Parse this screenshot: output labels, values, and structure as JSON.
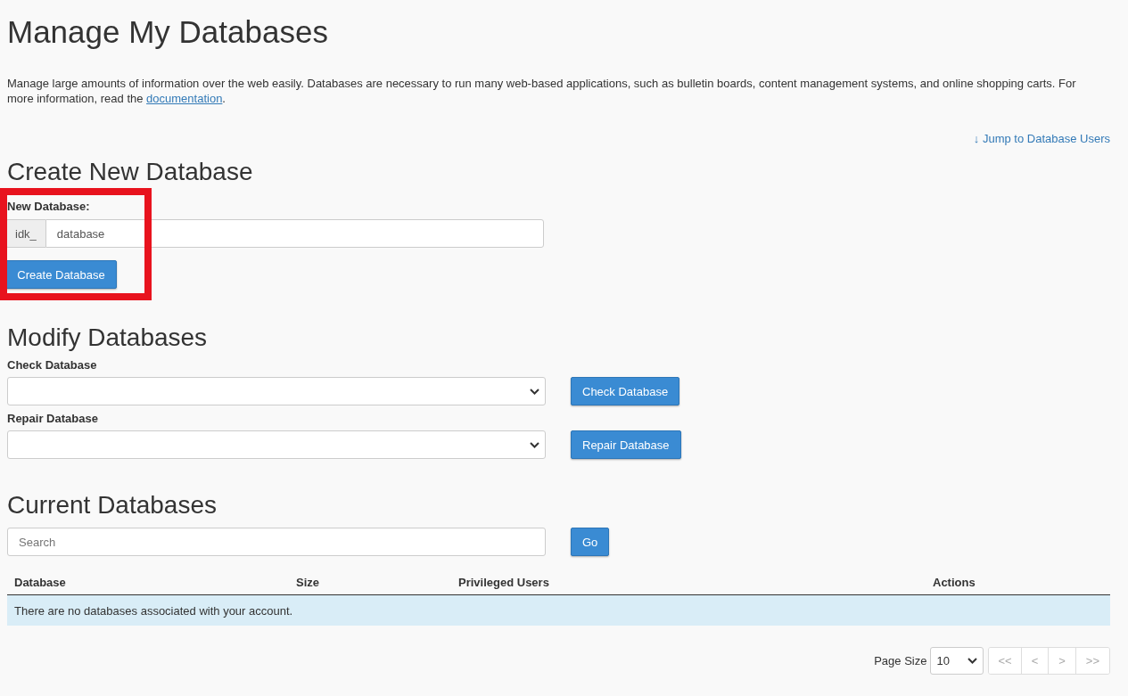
{
  "page_title": "Manage My Databases",
  "description": "Manage large amounts of information over the web easily. Databases are necessary to run many web-based applications, such as bulletin boards, content management systems, and online shopping carts. For more information, read the ",
  "description_link": "documentation",
  "description_end": ".",
  "jump_link": {
    "icon": "↓",
    "label": "Jump to Database Users"
  },
  "create_section": {
    "title": "Create New Database",
    "highlighted": true,
    "label": "New Database:",
    "prefix": "idk_",
    "value": "database",
    "button": "Create Database"
  },
  "modify_section": {
    "title": "Modify Databases",
    "rows": [
      {
        "label": "Check Database",
        "button": "Check Database"
      },
      {
        "label": "Repair Database",
        "button": "Repair Database"
      }
    ]
  },
  "current_section": {
    "title": "Current Databases",
    "search": {
      "placeholder": "Search"
    },
    "go_button": "Go",
    "table": {
      "columns": [
        "Database",
        "Size",
        "Privileged Users",
        "Actions"
      ],
      "empty_message": "There are no databases associated with your account."
    }
  },
  "pager": {
    "label": "Page Size",
    "page_size": "10",
    "buttons": [
      {
        "label": "<<",
        "disabled": true
      },
      {
        "label": "<",
        "disabled": true
      },
      {
        "label": ">",
        "disabled": true
      },
      {
        "label": ">>",
        "disabled": true
      }
    ]
  }
}
